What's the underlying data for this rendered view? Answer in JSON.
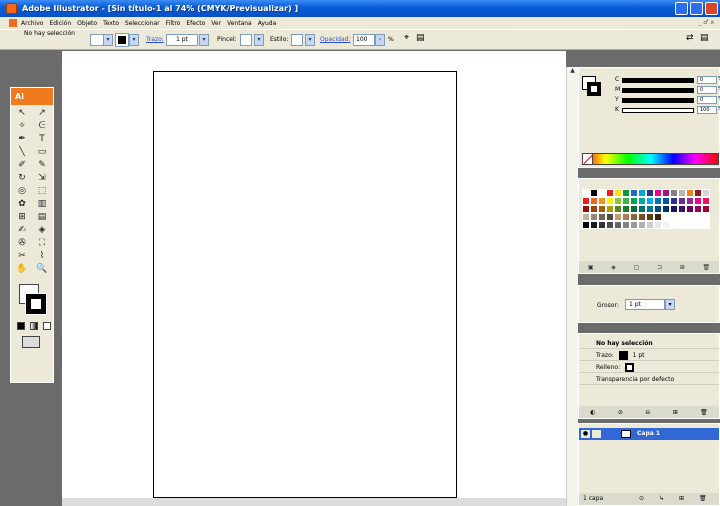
{
  "window": {
    "title": "Adobe Illustrator - [Sin título-1 al 74% (CMYK/Previsualizar) ]"
  },
  "menu": {
    "items": [
      "Archivo",
      "Edición",
      "Objeto",
      "Texto",
      "Seleccionar",
      "Filtro",
      "Efecto",
      "Ver",
      "Ventana",
      "Ayuda"
    ],
    "mdi_controls": "_ ♂ x"
  },
  "controlbar": {
    "selection_label": "No hay selección",
    "stroke_label": "Trazo:",
    "stroke_value": "1 pt",
    "brush_label": "Pincel:",
    "style_label": "Estilo:",
    "opacity_label": "Opacidad:",
    "opacity_value": "100",
    "percent": "%"
  },
  "toolbox": {
    "logo": "Ai",
    "tools": [
      "selection-tool",
      "direct-selection-tool",
      "magic-wand-tool",
      "lasso-tool",
      "pen-tool",
      "type-tool",
      "line-tool",
      "rectangle-tool",
      "paintbrush-tool",
      "pencil-tool",
      "rotate-tool",
      "scale-tool",
      "warp-tool",
      "free-transform-tool",
      "symbol-sprayer-tool",
      "graph-tool",
      "mesh-tool",
      "gradient-tool",
      "eyedropper-tool",
      "blend-tool",
      "live-paint-tool",
      "live-paint-selection-tool",
      "slice-tool",
      "scissors-tool",
      "hand-tool",
      "zoom-tool"
    ],
    "tool_glyphs": [
      "↖",
      "↗",
      "✧",
      "ᕮ",
      "✒",
      "T",
      "╲",
      "▭",
      "✐",
      "✎",
      "↻",
      "⇲",
      "◎",
      "⬚",
      "✿",
      "▥",
      "⊞",
      "▤",
      "✍",
      "◈",
      "✇",
      "⛶",
      "✂",
      "⌇",
      "✋",
      "🔍"
    ]
  },
  "color_panel": {
    "channels": [
      {
        "label": "C",
        "value": "0",
        "unit": "%"
      },
      {
        "label": "M",
        "value": "0",
        "unit": "%"
      },
      {
        "label": "Y",
        "value": "0",
        "unit": "%"
      },
      {
        "label": "K",
        "value": "100",
        "unit": "%"
      }
    ]
  },
  "swatches": {
    "colors": [
      "#ffffff",
      "#000000",
      "#ffffff",
      "#e0231c",
      "#f7e600",
      "#0e9a3a",
      "#1d6cc5",
      "#00a6d6",
      "#2f3192",
      "#ec008c",
      "#a5157a",
      "#808080",
      "#b7b7b7",
      "#f58220",
      "#8b1c1c",
      "#d6d6d6",
      "#ed1c24",
      "#f26522",
      "#f7941d",
      "#fff200",
      "#8dc63f",
      "#39b54a",
      "#00a651",
      "#00a99d",
      "#00aeef",
      "#0072bc",
      "#0054a6",
      "#2e3192",
      "#662d91",
      "#92278f",
      "#ec008c",
      "#ed145b",
      "#9e0b0f",
      "#a0410d",
      "#a3620a",
      "#aba000",
      "#598527",
      "#197b30",
      "#007236",
      "#00746b",
      "#0076a3",
      "#004b80",
      "#003471",
      "#1b1464",
      "#440e62",
      "#630460",
      "#9e005d",
      "#9e0039",
      "#c7b299",
      "#998675",
      "#736357",
      "#534741",
      "#c69c6d",
      "#a67c52",
      "#8c6239",
      "#754c24",
      "#603913",
      "#3c2415",
      "#ffffff",
      "#ffffff",
      "#ffffff",
      "#ffffff",
      "#ffffff",
      "#ffffff",
      "#000000",
      "#1a1a1a",
      "#333333",
      "#4d4d4d",
      "#666666",
      "#808080",
      "#999999",
      "#b3b3b3",
      "#cccccc",
      "#e6e6e6",
      "#f2f2f2",
      "#ffffff",
      "#ffffff",
      "#ffffff",
      "#ffffff",
      "#ffffff"
    ]
  },
  "stroke_panel": {
    "weight_label": "Grosor:",
    "weight_value": "1 pt"
  },
  "appearance_panel": {
    "header": "No hay selección",
    "stroke_label": "Trazo:",
    "stroke_value": "1 pt",
    "fill_label": "Relleno:",
    "transparency": "Transparencia por defecto"
  },
  "layers_panel": {
    "layer_name": "Capa 1",
    "count": "1 capa"
  }
}
